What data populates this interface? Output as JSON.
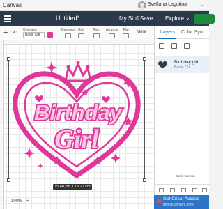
{
  "app": {
    "name": "Canvas",
    "user_name": "Svetlana Lagutina"
  },
  "header": {
    "doc_title": "Untitled*",
    "my_stuff": "My Stuff",
    "save": "Save",
    "explore": "Explore"
  },
  "toolbar": {
    "operation_label": "Operation",
    "operation_value": "Basic Cut",
    "groups": [
      "Deselect",
      "Edit",
      "Align",
      "Arrange",
      "Flip"
    ],
    "more": "More"
  },
  "canvas": {
    "dimensions": "15.48 cm × 15.23 cm",
    "zoom": "100%"
  },
  "design": {
    "line1": "Birthday",
    "line2": "Girl",
    "color": "#e0389a"
  },
  "panel": {
    "tabs": [
      "Layers",
      "Color Sync"
    ],
    "layer": {
      "name": "Birthday girl",
      "operation": "Basic Cut"
    },
    "blank_canvas": "Blank Canvas"
  },
  "promo": {
    "title": "Get Cricut Access",
    "subtitle": "unlock content, free"
  }
}
